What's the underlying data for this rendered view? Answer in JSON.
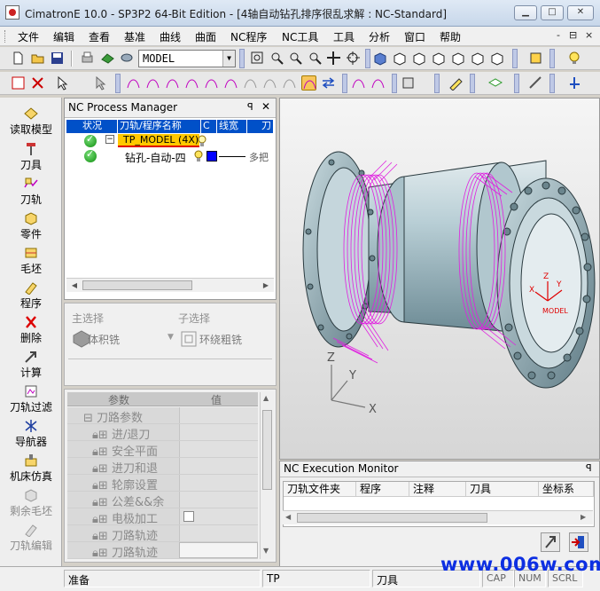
{
  "window": {
    "title": "CimatronE 10.0 - SP3P2 64-Bit Edition - [4轴自动钻孔排序很乱求解 : NC-Standard]",
    "min_icon": "minimize-icon",
    "max_icon": "maximize-icon",
    "close_icon": "close-icon"
  },
  "menu": {
    "items": [
      "文件",
      "编辑",
      "查看",
      "基准",
      "曲线",
      "曲面",
      "NC程序",
      "NC工具",
      "工具",
      "分析",
      "窗口",
      "帮助"
    ],
    "mdi_min": "-",
    "mdi_restore": "⊟",
    "mdi_close": "×"
  },
  "toolbar": {
    "model_combo": "MODEL"
  },
  "leftbar": {
    "commands": [
      {
        "label": "读取模型",
        "icon": "load-model-icon",
        "enabled": true
      },
      {
        "label": "刀具",
        "icon": "tool-icon",
        "enabled": true
      },
      {
        "label": "刀轨",
        "icon": "toolpath-icon",
        "enabled": true
      },
      {
        "label": "零件",
        "icon": "part-icon",
        "enabled": true
      },
      {
        "label": "毛坯",
        "icon": "stock-icon",
        "enabled": true
      },
      {
        "label": "程序",
        "icon": "procedure-icon",
        "enabled": true
      },
      {
        "label": "删除",
        "icon": "delete-icon",
        "enabled": true
      },
      {
        "label": "计算",
        "icon": "execute-icon",
        "enabled": true
      },
      {
        "label": "刀轨过滤",
        "icon": "toolpath-filter-icon",
        "enabled": true
      },
      {
        "label": "导航器",
        "icon": "navigator-icon",
        "enabled": true
      },
      {
        "label": "机床仿真",
        "icon": "machine-sim-icon",
        "enabled": true
      },
      {
        "label": "剩余毛坯",
        "icon": "remaining-stock-icon",
        "enabled": false
      },
      {
        "label": "刀轨编辑",
        "icon": "toolpath-edit-icon",
        "enabled": false
      }
    ]
  },
  "process_manager": {
    "title": "NC Process Manager",
    "pin": "ᵖ",
    "close": "×",
    "columns": [
      "状况",
      "刀轨/程序名称",
      "C",
      "线宽",
      "刀"
    ],
    "rows": [
      {
        "name": "TP_MODEL (4X)",
        "expander": "−",
        "selected": true
      },
      {
        "name": "钻孔-自动-四",
        "tool_text": "多把"
      }
    ]
  },
  "selection": {
    "main_label": "主选择",
    "sub_label": "子选择",
    "main_value": "体积铣",
    "sub_value": "环绕粗铣"
  },
  "params": {
    "col_param": "参数",
    "col_value": "值",
    "group": "刀路参数",
    "rows": [
      "进/退刀",
      "安全平面",
      "进刀和退",
      "轮廓设置",
      "公差&&余",
      "电极加工",
      "刀路轨迹",
      "刀路轨迹"
    ]
  },
  "viewport": {
    "axis_labels": {
      "z": "Z",
      "y": "Y",
      "x": "X"
    },
    "model_label": "MODEL",
    "colors": {
      "part": "#b9cfd6",
      "toolpath": "#e020e0",
      "axis_red": "#e00000"
    }
  },
  "exec_monitor": {
    "title": "NC Execution Monitor",
    "pin": "ᵖ",
    "columns": [
      "刀轨文件夹",
      "程序",
      "注释",
      "刀具",
      "坐标系"
    ]
  },
  "status": {
    "ready": "准备",
    "tp": "TP",
    "tool": "刀具",
    "cap": "CAP",
    "num": "NUM",
    "scrl": "SCRL"
  },
  "watermark": "www.006w.com"
}
